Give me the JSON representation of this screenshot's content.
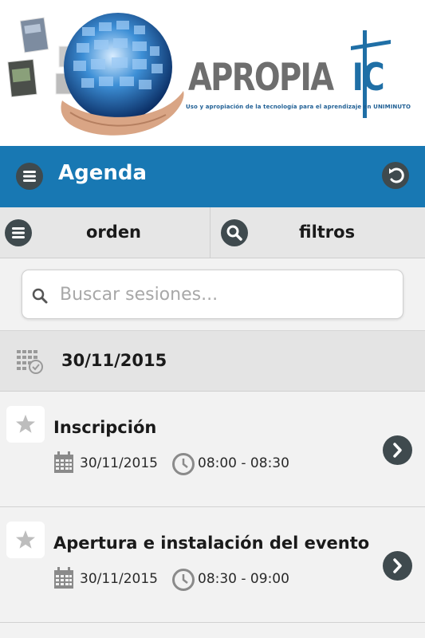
{
  "banner": {
    "brand_main": "APROPIA",
    "brand_accent": "IC",
    "tagline": "Uso y apropiación de la tecnología para el aprendizaje en UNIMINUTO"
  },
  "header": {
    "title": "Agenda",
    "menu_icon": "menu-icon",
    "back_icon": "undo-icon"
  },
  "toolbar": {
    "orden_label": "orden",
    "filtros_label": "filtros"
  },
  "search": {
    "placeholder": "Buscar sesiones...",
    "value": ""
  },
  "agenda": {
    "date": "30/11/2015",
    "sessions": [
      {
        "title": "Inscripción",
        "date": "30/11/2015",
        "time": "08:00 - 08:30"
      },
      {
        "title": "Apertura e instalación del evento",
        "date": "30/11/2015",
        "time": "08:30 - 09:00"
      }
    ]
  },
  "colors": {
    "header_bg": "#1878b3",
    "button_bg": "#3f4a4e",
    "brand_accent": "#1f6fa6"
  }
}
